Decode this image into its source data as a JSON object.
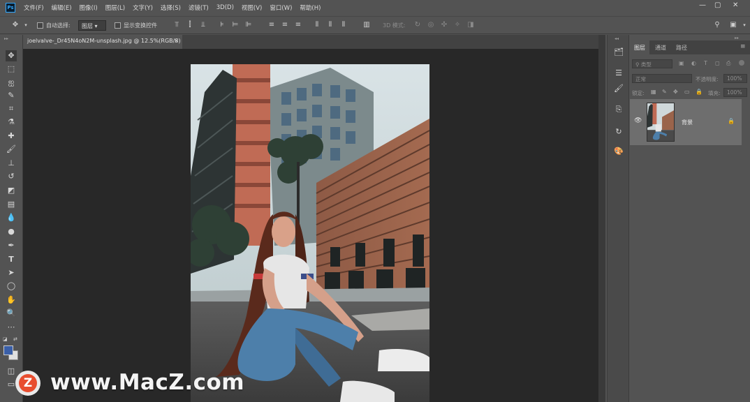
{
  "app": {
    "logo_text": "Ps"
  },
  "menu": [
    "文件(F)",
    "编辑(E)",
    "图像(I)",
    "图层(L)",
    "文字(Y)",
    "选择(S)",
    "滤镜(T)",
    "3D(D)",
    "视图(V)",
    "窗口(W)",
    "帮助(H)"
  ],
  "window_controls": {
    "minimize": "—",
    "maximize": "▢",
    "close": "✕"
  },
  "options": {
    "auto_select_label": "自动选择:",
    "auto_select_target": "图层",
    "show_transform_label": "显示变换控件",
    "mode_3d_label": "3D 模式:"
  },
  "document": {
    "tab_title": "joelvalve-_Dr45N4oN2M-unsplash.jpg @ 12.5%(RGB/8)",
    "close_glyph": "×"
  },
  "layers_panel": {
    "tabs": [
      "图层",
      "通道",
      "路径"
    ],
    "filter_label": "类型",
    "blend_mode": "正常",
    "opacity_label": "不透明度:",
    "opacity_value": "100%",
    "lock_label": "锁定:",
    "fill_label": "填充:",
    "fill_value": "100%",
    "layers": [
      {
        "name": "背景",
        "visible": true,
        "locked": true
      }
    ]
  },
  "watermark": {
    "logo_letter": "Z",
    "text": "www.MacZ.com"
  },
  "colors": {
    "accent": "#31a8ff",
    "watermark_red": "#e84d2f",
    "foreground": "#3a5fa8",
    "background": "#e0e0e0"
  }
}
